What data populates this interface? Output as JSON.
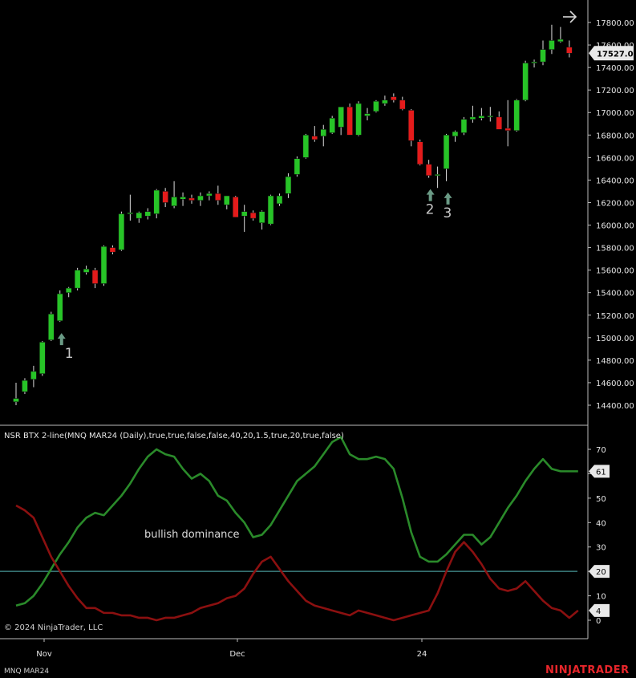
{
  "chart_data": [
    {
      "type": "candlestick",
      "price_axis": {
        "ticks": [
          "17800.00",
          "17600.00",
          "17400.00",
          "17200.00",
          "17000.00",
          "16800.00",
          "16600.00",
          "16400.00",
          "16200.00",
          "16000.00",
          "15800.00",
          "15600.00",
          "15400.00",
          "15200.00",
          "15000.00",
          "14800.00",
          "14600.00",
          "14400.00"
        ],
        "ylim": [
          14290,
          17980
        ],
        "current_price_label": "17527.00"
      },
      "candles": [
        {
          "o": 14430,
          "h": 14600,
          "l": 14400,
          "c": 14460
        },
        {
          "o": 14520,
          "h": 14640,
          "l": 14500,
          "c": 14620
        },
        {
          "o": 14630,
          "h": 14750,
          "l": 14560,
          "c": 14700
        },
        {
          "o": 14680,
          "h": 14970,
          "l": 14660,
          "c": 14960
        },
        {
          "o": 14980,
          "h": 15230,
          "l": 14970,
          "c": 15210
        },
        {
          "o": 15150,
          "h": 15420,
          "l": 15140,
          "c": 15390
        },
        {
          "o": 15400,
          "h": 15450,
          "l": 15360,
          "c": 15440
        },
        {
          "o": 15440,
          "h": 15620,
          "l": 15420,
          "c": 15600
        },
        {
          "o": 15580,
          "h": 15640,
          "l": 15560,
          "c": 15610
        },
        {
          "o": 15600,
          "h": 15620,
          "l": 15440,
          "c": 15480
        },
        {
          "o": 15480,
          "h": 15820,
          "l": 15460,
          "c": 15810
        },
        {
          "o": 15800,
          "h": 15820,
          "l": 15740,
          "c": 15760
        },
        {
          "o": 15780,
          "h": 16120,
          "l": 15770,
          "c": 16100
        },
        {
          "o": 16100,
          "h": 16270,
          "l": 16040,
          "c": 16110
        },
        {
          "o": 16060,
          "h": 16120,
          "l": 16020,
          "c": 16110
        },
        {
          "o": 16080,
          "h": 16150,
          "l": 16050,
          "c": 16120
        },
        {
          "o": 16100,
          "h": 16320,
          "l": 16060,
          "c": 16310
        },
        {
          "o": 16300,
          "h": 16330,
          "l": 16160,
          "c": 16200
        },
        {
          "o": 16170,
          "h": 16390,
          "l": 16150,
          "c": 16250
        },
        {
          "o": 16230,
          "h": 16290,
          "l": 16170,
          "c": 16250
        },
        {
          "o": 16240,
          "h": 16270,
          "l": 16190,
          "c": 16220
        },
        {
          "o": 16220,
          "h": 16290,
          "l": 16170,
          "c": 16260
        },
        {
          "o": 16260,
          "h": 16300,
          "l": 16220,
          "c": 16280
        },
        {
          "o": 16280,
          "h": 16350,
          "l": 16180,
          "c": 16220
        },
        {
          "o": 16180,
          "h": 16260,
          "l": 16140,
          "c": 16260
        },
        {
          "o": 16250,
          "h": 16260,
          "l": 16070,
          "c": 16070
        },
        {
          "o": 16080,
          "h": 16180,
          "l": 15940,
          "c": 16120
        },
        {
          "o": 16110,
          "h": 16130,
          "l": 16040,
          "c": 16060
        },
        {
          "o": 16020,
          "h": 16130,
          "l": 15960,
          "c": 16120
        },
        {
          "o": 16010,
          "h": 16270,
          "l": 16000,
          "c": 16260
        },
        {
          "o": 16190,
          "h": 16280,
          "l": 16170,
          "c": 16260
        },
        {
          "o": 16280,
          "h": 16460,
          "l": 16240,
          "c": 16430
        },
        {
          "o": 16450,
          "h": 16610,
          "l": 16430,
          "c": 16590
        },
        {
          "o": 16600,
          "h": 16810,
          "l": 16590,
          "c": 16800
        },
        {
          "o": 16790,
          "h": 16880,
          "l": 16740,
          "c": 16760
        },
        {
          "o": 16790,
          "h": 16890,
          "l": 16700,
          "c": 16850
        },
        {
          "o": 16820,
          "h": 16970,
          "l": 16810,
          "c": 16950
        },
        {
          "o": 16870,
          "h": 17020,
          "l": 16800,
          "c": 17050
        },
        {
          "o": 17050,
          "h": 17080,
          "l": 16800,
          "c": 16800
        },
        {
          "o": 16800,
          "h": 17100,
          "l": 16790,
          "c": 17080
        },
        {
          "o": 16970,
          "h": 17040,
          "l": 16930,
          "c": 16990
        },
        {
          "o": 17010,
          "h": 17110,
          "l": 17000,
          "c": 17100
        },
        {
          "o": 17080,
          "h": 17150,
          "l": 17060,
          "c": 17110
        },
        {
          "o": 17140,
          "h": 17170,
          "l": 17090,
          "c": 17110
        },
        {
          "o": 17110,
          "h": 17140,
          "l": 17020,
          "c": 17030
        },
        {
          "o": 17020,
          "h": 17030,
          "l": 16700,
          "c": 16750
        },
        {
          "o": 16740,
          "h": 16760,
          "l": 16530,
          "c": 16540
        },
        {
          "o": 16540,
          "h": 16580,
          "l": 16420,
          "c": 16440
        },
        {
          "o": 16450,
          "h": 16520,
          "l": 16330,
          "c": 16450
        },
        {
          "o": 16500,
          "h": 16810,
          "l": 16390,
          "c": 16800
        },
        {
          "o": 16790,
          "h": 16840,
          "l": 16740,
          "c": 16830
        },
        {
          "o": 16820,
          "h": 16960,
          "l": 16800,
          "c": 16940
        },
        {
          "o": 16940,
          "h": 17060,
          "l": 16910,
          "c": 16960
        },
        {
          "o": 16950,
          "h": 17040,
          "l": 16930,
          "c": 16970
        },
        {
          "o": 16960,
          "h": 17050,
          "l": 16920,
          "c": 16970
        },
        {
          "o": 16960,
          "h": 17010,
          "l": 16860,
          "c": 16850
        },
        {
          "o": 16860,
          "h": 17110,
          "l": 16700,
          "c": 16840
        },
        {
          "o": 16840,
          "h": 17120,
          "l": 16830,
          "c": 17110
        },
        {
          "o": 17110,
          "h": 17460,
          "l": 17100,
          "c": 17440
        },
        {
          "o": 17440,
          "h": 17470,
          "l": 17400,
          "c": 17450
        },
        {
          "o": 17450,
          "h": 17640,
          "l": 17420,
          "c": 17560
        },
        {
          "o": 17560,
          "h": 17780,
          "l": 17520,
          "c": 17640
        },
        {
          "o": 17630,
          "h": 17760,
          "l": 17620,
          "c": 17650
        },
        {
          "o": 17580,
          "h": 17640,
          "l": 17490,
          "c": 17527
        }
      ],
      "signals": [
        {
          "candle_index": 5,
          "label": "1"
        },
        {
          "candle_index": 47,
          "label": "2"
        },
        {
          "candle_index": 49,
          "label": "3"
        }
      ]
    },
    {
      "type": "line",
      "title": "NSR BTX 2-line(MNQ MAR24 (Daily),true,true,false,false,40,20,1.5,true,20,true,false)",
      "annotation": "bullish dominance",
      "ylim": [
        -2,
        77
      ],
      "yticks": [
        "70",
        "60",
        "50",
        "40",
        "30",
        "20",
        "10",
        "0"
      ],
      "level_line": 20,
      "value_labels": [
        "61",
        "20",
        "4"
      ],
      "series": [
        {
          "color": "#2a8a2a",
          "values": [
            6,
            7,
            10,
            14,
            20,
            27,
            32,
            38,
            42,
            45,
            44,
            46,
            52,
            57,
            60,
            66,
            68,
            66,
            67,
            64,
            60,
            61,
            58,
            52,
            49,
            44,
            41,
            34,
            35,
            38,
            43,
            49,
            55,
            60,
            62,
            66,
            71,
            75,
            68,
            68,
            66,
            66,
            67,
            65,
            57,
            44,
            32,
            24,
            24,
            27,
            32,
            36,
            35,
            31,
            34,
            40,
            46,
            51,
            57,
            61,
            58,
            55,
            60,
            65,
            61
          ],
          "values_smooth": [
            6,
            7,
            10,
            15,
            21,
            27,
            32,
            38,
            42,
            44,
            43,
            47,
            51,
            56,
            62,
            67,
            70,
            68,
            67,
            62,
            58,
            60,
            57,
            51,
            49,
            44,
            40,
            34,
            35,
            39,
            45,
            51,
            57,
            60,
            63,
            68,
            73,
            75,
            68,
            66,
            66,
            67,
            66,
            62,
            50,
            36,
            26,
            24,
            24,
            27,
            31,
            35,
            35,
            31,
            34,
            40,
            46,
            51,
            57,
            62,
            66,
            62,
            61,
            61,
            61
          ]
        },
        {
          "color": "#8b1010",
          "values": [
            47,
            45,
            42,
            34,
            26,
            20,
            14,
            9,
            5,
            5,
            3,
            3,
            2,
            2,
            1,
            1,
            0,
            1,
            1,
            2,
            3,
            5,
            6,
            7,
            9,
            10,
            13,
            19,
            24,
            26,
            21,
            16,
            12,
            8,
            6,
            5,
            4,
            3,
            2,
            4,
            3,
            2,
            1,
            0,
            1,
            2,
            3,
            4,
            11,
            20,
            28,
            32,
            28,
            23,
            17,
            13,
            12,
            13,
            16,
            12,
            8,
            5,
            4,
            1,
            4
          ]
        }
      ]
    }
  ],
  "x_axis": {
    "labels": [
      "Nov",
      "Dec",
      "24"
    ]
  },
  "ui": {
    "copyright": "© 2024 NinjaTrader, LLC",
    "instrument": "MNQ MAR24",
    "brand": "NINJATRADER",
    "scroll_arrow_icon": "arrow-right-icon"
  },
  "colors": {
    "up": "#27c427",
    "down": "#e41b1b",
    "wick": "#dddddd",
    "signal": "#6a9a85",
    "green_line": "#2a8a2a",
    "red_line": "#8b1010",
    "level_line": "#3c8080",
    "brand": "#e8262b"
  }
}
